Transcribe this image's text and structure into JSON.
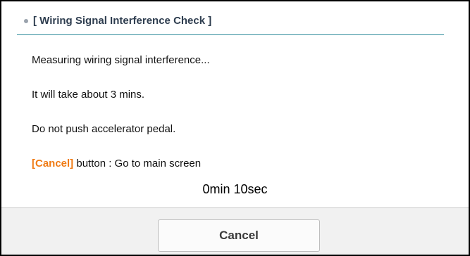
{
  "dialog": {
    "title": "[ Wiring Signal Interference Check ]",
    "messages": [
      "Measuring wiring signal interference...",
      "It will take about 3 mins.",
      "Do not push accelerator pedal."
    ],
    "cancel_hint": {
      "keyword": "[Cancel]",
      "text": " button : Go to main screen"
    },
    "timer": "0min 10sec"
  },
  "footer": {
    "cancel_label": "Cancel"
  },
  "colors": {
    "accent_line": "#2e8a9a",
    "hint_highlight": "#f07b14",
    "title_text": "#2e3d4f"
  },
  "icons": {
    "bullet": "bullet-dot-icon"
  }
}
